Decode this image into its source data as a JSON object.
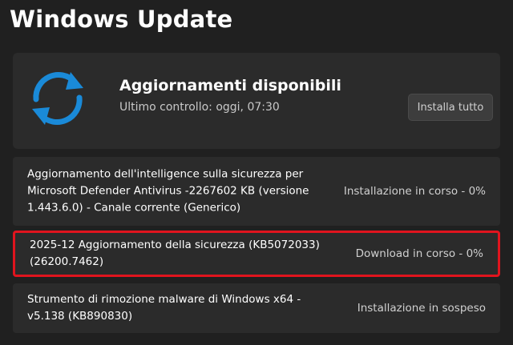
{
  "page": {
    "title": "Windows Update"
  },
  "status": {
    "title": "Aggiornamenti disponibili",
    "last_check": "Ultimo controllo: oggi, 07:30",
    "install_all_label": "Installa tutto"
  },
  "updates": [
    {
      "description": "Aggiornamento dell'intelligence sulla sicurezza per Microsoft Defender Antivirus -2267602 KB (versione 1.443.6.0) - Canale corrente (Generico)",
      "state": "Installazione in corso - 0%"
    },
    {
      "description": "2025-12 Aggiornamento della sicurezza (KB5072033) (26200.7462)",
      "state": "Download in corso - 0%"
    },
    {
      "description": "Strumento di rimozione malware di Windows x64 - v5.138 (KB890830)",
      "state": "Installazione in sospeso"
    }
  ],
  "colors": {
    "accent": "#1a8ad8",
    "highlight_border": "#e0141e",
    "background": "#202020",
    "card": "#2b2b2b"
  },
  "icons": {
    "status": "sync-arrows-icon"
  }
}
